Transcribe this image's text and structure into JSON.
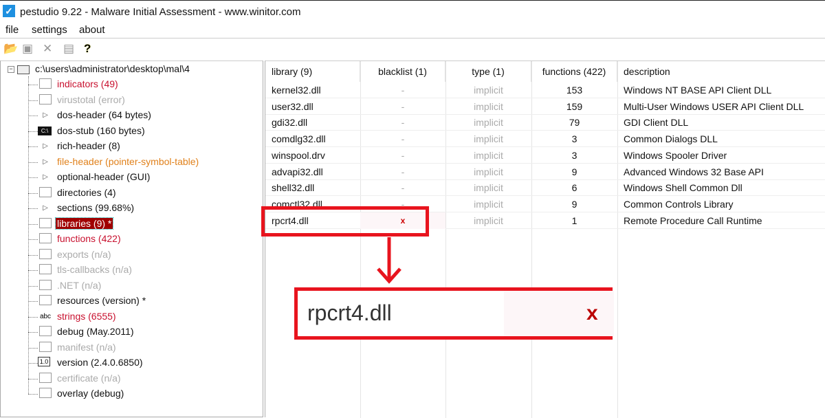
{
  "window": {
    "title": "pestudio 9.22 - Malware Initial Assessment - www.winitor.com"
  },
  "menu": [
    "file",
    "settings",
    "about"
  ],
  "toolbar": {
    "icons": [
      "open-folder-icon",
      "save-icon",
      "close-icon",
      "clipboard-icon",
      "help-icon"
    ],
    "help_glyph": "?"
  },
  "tree": {
    "root": "c:\\users\\administrator\\desktop\\mal\\4",
    "items": [
      {
        "label": "indicators (49)",
        "style": "red",
        "icon": "bar-chart-icon"
      },
      {
        "label": "virustotal (error)",
        "style": "gray",
        "icon": "virustotal-icon"
      },
      {
        "label": "dos-header (64 bytes)",
        "style": "normal",
        "icon": "expand-arrow-icon"
      },
      {
        "label": "dos-stub (160 bytes)",
        "style": "normal",
        "icon": "console-icon"
      },
      {
        "label": "rich-header (8)",
        "style": "normal",
        "icon": "expand-arrow-icon"
      },
      {
        "label": "file-header (pointer-symbol-table)",
        "style": "orange",
        "icon": "expand-arrow-icon"
      },
      {
        "label": "optional-header (GUI)",
        "style": "normal",
        "icon": "expand-arrow-icon"
      },
      {
        "label": "directories (4)",
        "style": "normal",
        "icon": "directories-icon"
      },
      {
        "label": "sections (99.68%)",
        "style": "normal",
        "icon": "expand-arrow-icon"
      },
      {
        "label": "libraries (9) *",
        "style": "selected",
        "icon": "import-icon"
      },
      {
        "label": "functions (422)",
        "style": "red",
        "icon": "import-icon"
      },
      {
        "label": "exports (n/a)",
        "style": "gray",
        "icon": "export-icon"
      },
      {
        "label": "tls-callbacks (n/a)",
        "style": "gray",
        "icon": "key-icon"
      },
      {
        "label": ".NET (n/a)",
        "style": "gray",
        "icon": "export-icon"
      },
      {
        "label": "resources (version) *",
        "style": "normal",
        "icon": "resources-icon"
      },
      {
        "label": "strings (6555)",
        "style": "red",
        "icon": "abc-icon",
        "icon_text": "abc"
      },
      {
        "label": "debug (May.2011)",
        "style": "normal",
        "icon": "bug-icon"
      },
      {
        "label": "manifest (n/a)",
        "style": "gray",
        "icon": "manifest-icon"
      },
      {
        "label": "version (2.4.0.6850)",
        "style": "normal",
        "icon": "version-icon",
        "icon_text": "1.0"
      },
      {
        "label": "certificate (n/a)",
        "style": "gray",
        "icon": "certificate-icon"
      },
      {
        "label": "overlay (debug)",
        "style": "normal",
        "icon": "file-icon"
      }
    ]
  },
  "table": {
    "headers": [
      "library (9)",
      "blacklist (1)",
      "type (1)",
      "functions (422)",
      "description"
    ],
    "rows": [
      [
        "kernel32.dll",
        "-",
        "implicit",
        "153",
        "Windows NT BASE API Client DLL"
      ],
      [
        "user32.dll",
        "-",
        "implicit",
        "159",
        "Multi-User Windows USER API Client DLL"
      ],
      [
        "gdi32.dll",
        "-",
        "implicit",
        "79",
        "GDI Client DLL"
      ],
      [
        "comdlg32.dll",
        "-",
        "implicit",
        "3",
        "Common Dialogs DLL"
      ],
      [
        "winspool.drv",
        "-",
        "implicit",
        "3",
        "Windows Spooler Driver"
      ],
      [
        "advapi32.dll",
        "-",
        "implicit",
        "9",
        "Advanced Windows 32 Base API"
      ],
      [
        "shell32.dll",
        "-",
        "implicit",
        "6",
        "Windows Shell Common Dll"
      ],
      [
        "comctl32.dll",
        "-",
        "implicit",
        "9",
        "Common Controls Library"
      ],
      [
        "rpcrt4.dll",
        "x",
        "implicit",
        "1",
        "Remote Procedure Call Runtime"
      ]
    ]
  },
  "callout": {
    "library": "rpcrt4.dll",
    "blacklist": "x",
    "color": "#e8141e"
  }
}
